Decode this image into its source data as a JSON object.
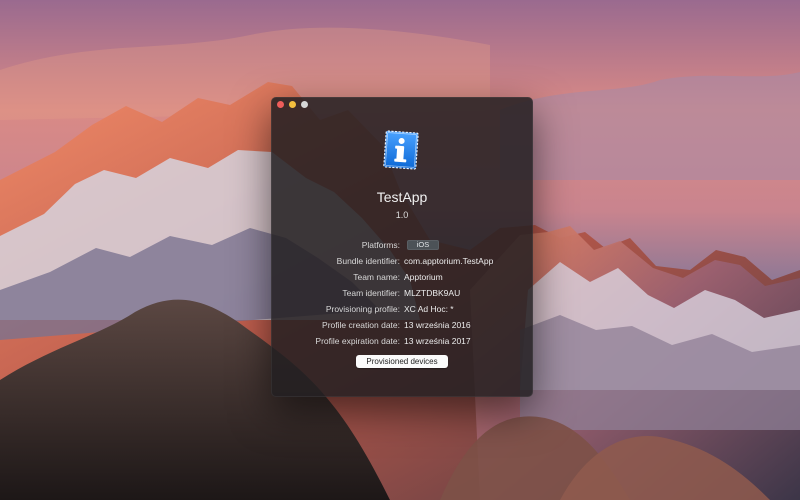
{
  "app": {
    "name": "TestApp",
    "version": "1.0",
    "icon": "info-icon"
  },
  "window": {
    "controls": [
      "close",
      "minimize",
      "zoom"
    ]
  },
  "details": {
    "platforms": {
      "label": "Platforms:",
      "value": "iOS"
    },
    "bundle_identifier": {
      "label": "Bundle identifier:",
      "value": "com.apptorium.TestApp"
    },
    "team_name": {
      "label": "Team name:",
      "value": "Apptorium"
    },
    "team_identifier": {
      "label": "Team identifier:",
      "value": "MLZTDBK9AU"
    },
    "provisioning_profile": {
      "label": "Provisioning profile:",
      "value": "XC Ad Hoc: *"
    },
    "profile_creation_date": {
      "label": "Profile creation date:",
      "value": "13 września 2016"
    },
    "profile_expiration_date": {
      "label": "Profile expiration date:",
      "value": "13 września 2017"
    }
  },
  "actions": {
    "provisioned_devices_label": "Provisioned devices"
  },
  "colors": {
    "close": "#ee5d5a",
    "minimize": "#f3be3e",
    "zoom": "#d6d6d6",
    "icon_blue": "#1f7fe0"
  }
}
